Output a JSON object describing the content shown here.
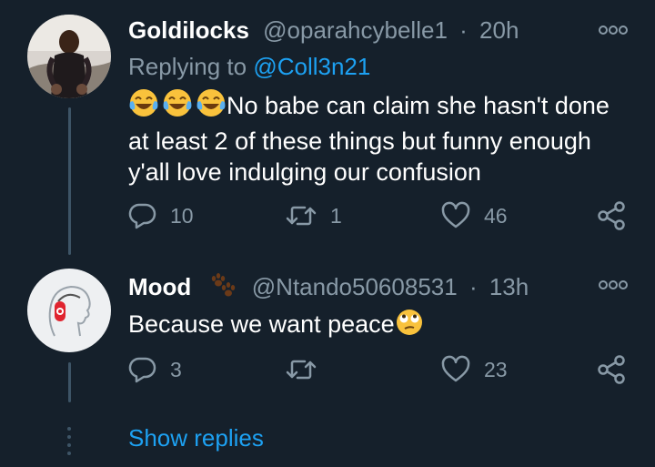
{
  "tweet1": {
    "name": "Goldilocks",
    "handle": "@oparahcybelle1",
    "separator": "·",
    "time": "20h",
    "replying_prefix": "Replying to ",
    "replying_to": "@Coll3n21",
    "emoji_desc": "face-with-tears-of-joy x3",
    "text_line1": "No babe can claim she hasn't done",
    "text_line2": "at least 2 of these things but funny enough",
    "text_line3": "y'all love indulging our confusion",
    "replies": "10",
    "retweets": "1",
    "likes": "46"
  },
  "tweet2": {
    "name": "Mood",
    "handle": "@Ntando50608531",
    "separator": "·",
    "time": "13h",
    "name_emoji": "paw-prints",
    "text": "Because we want peace",
    "trailing_emoji": "face-with-rolling-eyes",
    "replies": "3",
    "retweets": "",
    "likes": "23"
  },
  "show_replies_label": "Show replies",
  "colors": {
    "background": "#15202b",
    "muted": "#8899a6",
    "accent": "#1da1f2",
    "thread_line": "#3d5466"
  }
}
